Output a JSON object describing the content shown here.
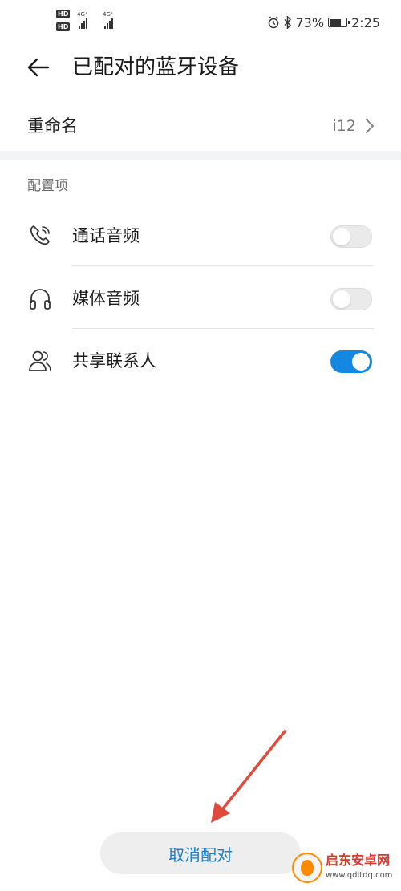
{
  "status_bar": {
    "hd1": "HD",
    "hd2": "HD",
    "net1": "4G⁺",
    "net2": "4G⁺",
    "battery_percent": "73%",
    "battery_level": 0.73,
    "time": "2:25",
    "icons": [
      "alarm-icon",
      "bluetooth-icon",
      "battery-icon",
      "signal-icon"
    ]
  },
  "header": {
    "back_icon": "arrow-left-icon",
    "title": "已配对的蓝牙设备"
  },
  "rename": {
    "label": "重命名",
    "value": "i12",
    "icon": "chevron-right-icon"
  },
  "config": {
    "section_label": "配置项",
    "items": [
      {
        "label": "通话音频",
        "icon": "phone-icon",
        "enabled": false
      },
      {
        "label": "媒体音频",
        "icon": "headphones-icon",
        "enabled": false
      },
      {
        "label": "共享联系人",
        "icon": "contacts-icon",
        "enabled": true
      }
    ]
  },
  "unpair_button": {
    "label": "取消配对"
  },
  "watermark": {
    "name": "启东安卓网",
    "url": "www.qdltdq.com"
  },
  "colors": {
    "accent": "#1488e0",
    "button_text": "#1a7fd0",
    "arrow": "#e04a3a"
  }
}
